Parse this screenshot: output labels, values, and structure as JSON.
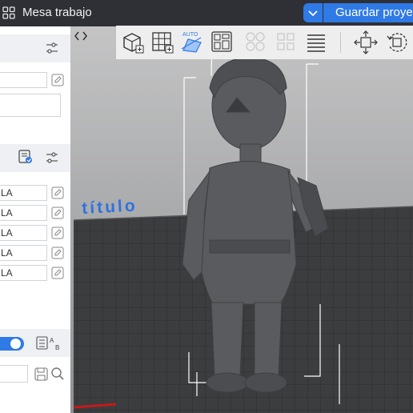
{
  "titlebar": {
    "title": "Mesa trabajo",
    "save_label": "Guardar proyecto"
  },
  "sidebar": {
    "name_fields": [
      "LA",
      "LA",
      "LA",
      "LA",
      "LA"
    ]
  },
  "viewport": {
    "bed_text": "título"
  },
  "colors": {
    "accent": "#2f7ae5",
    "titlebar": "#2f3036",
    "bed": "#3a3b3d",
    "model": "#5a5b5e"
  }
}
